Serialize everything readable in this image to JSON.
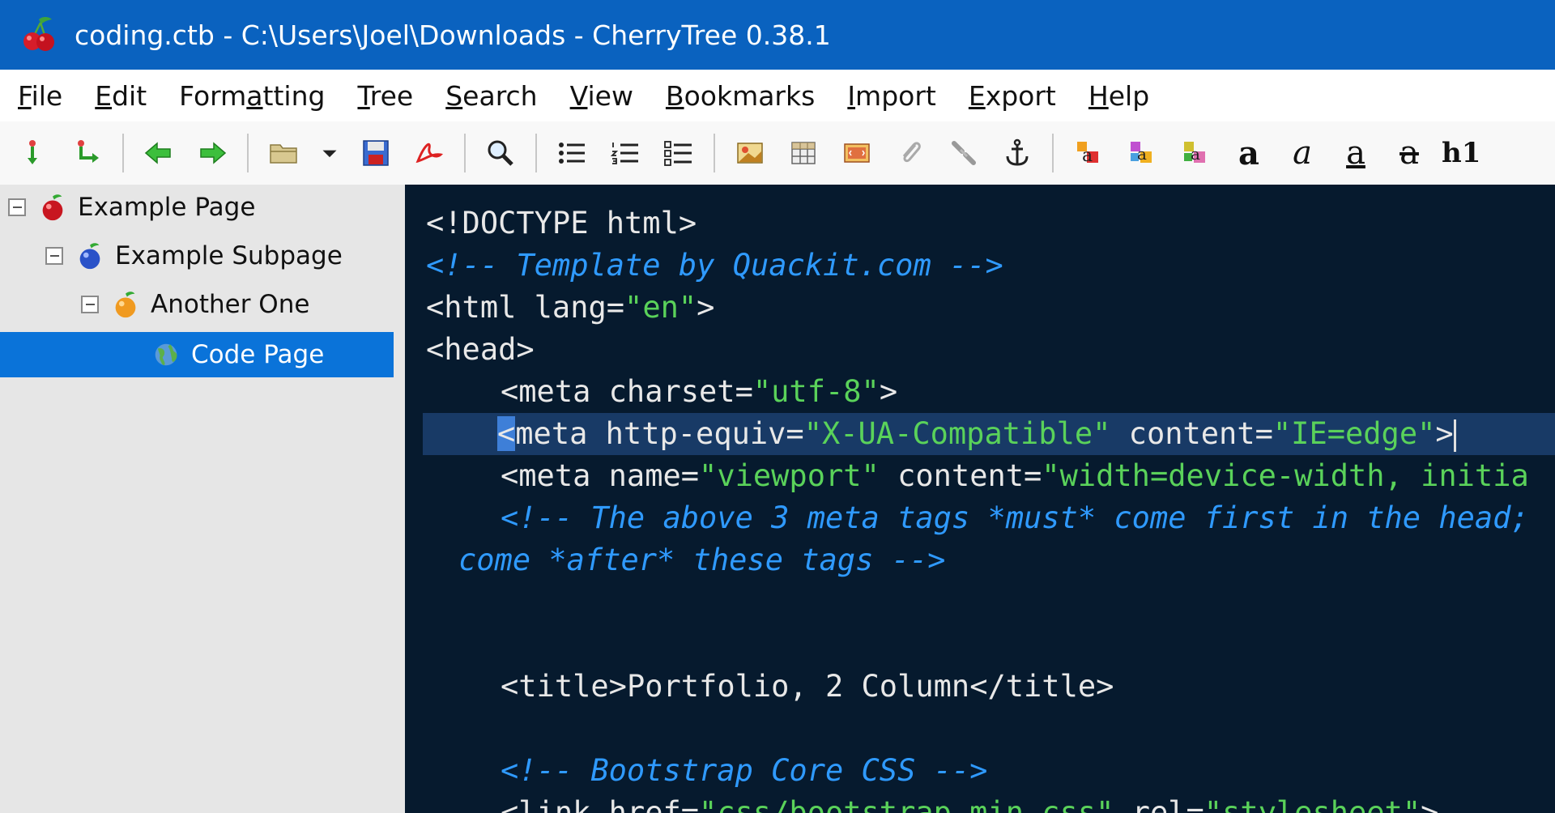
{
  "window": {
    "title": "coding.ctb - C:\\Users\\Joel\\Downloads - CherryTree 0.38.1"
  },
  "menu": [
    {
      "pre": "",
      "u": "F",
      "post": "ile"
    },
    {
      "pre": "",
      "u": "E",
      "post": "dit"
    },
    {
      "pre": "Form",
      "u": "a",
      "post": "tting"
    },
    {
      "pre": "",
      "u": "T",
      "post": "ree"
    },
    {
      "pre": "",
      "u": "S",
      "post": "earch"
    },
    {
      "pre": "",
      "u": "V",
      "post": "iew"
    },
    {
      "pre": "",
      "u": "B",
      "post": "ookmarks"
    },
    {
      "pre": "",
      "u": "I",
      "post": "mport"
    },
    {
      "pre": "",
      "u": "E",
      "post": "xport"
    },
    {
      "pre": "",
      "u": "H",
      "post": "elp"
    }
  ],
  "toolbar": {
    "format_text": {
      "bold": "a",
      "italic": "a",
      "underline": "a",
      "strike": "a",
      "heading": "h1"
    }
  },
  "tree": [
    {
      "label": "Example Page"
    },
    {
      "label": "Example Subpage"
    },
    {
      "label": "Another One"
    },
    {
      "label": "Code Page"
    }
  ],
  "editor": {
    "lines": [
      "<!DOCTYPE html>",
      "<!-- Template by Quackit.com -->",
      "<html lang=",
      "\"en\"",
      ">",
      "<head>",
      "<meta charset=",
      "\"utf-8\"",
      ">",
      "<",
      "meta http-equiv=",
      "\"X-UA-Compatible\"",
      " content=",
      "\"IE=edge\"",
      ">",
      "<meta name=",
      "\"viewport\"",
      " content=",
      "\"width=device-width, initia",
      "<!-- The above 3 meta tags *must* come first in the head;",
      "come *after* these tags -->",
      "<title>",
      "Portfolio, 2 Column",
      "</title>",
      "<!-- Bootstrap Core CSS -->",
      "<link href=",
      "\"css/bootstrap.min.css\"",
      " rel=",
      "\"stylesheet\"",
      ">"
    ]
  },
  "colors": {
    "titlebar": "#0a62bf",
    "selection": "#0a73d9",
    "editor_bg": "#061a2e",
    "string": "#5ad25a",
    "comment": "#2f9aff"
  }
}
